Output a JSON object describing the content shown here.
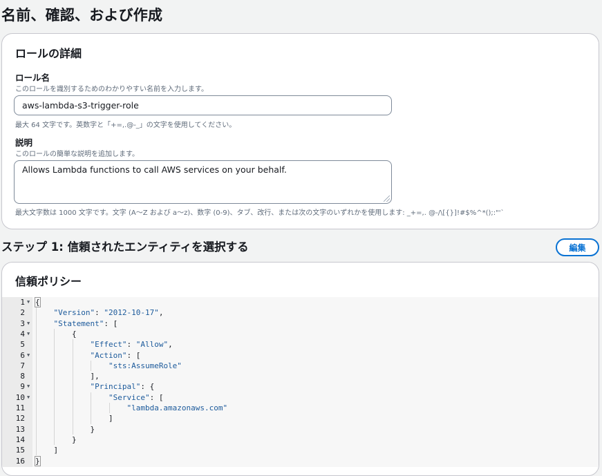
{
  "page": {
    "title": "名前、確認、および作成"
  },
  "role_details": {
    "title": "ロールの詳細",
    "role_name": {
      "label": "ロール名",
      "description": "このロールを識別するためのわかりやすい名前を入力します。",
      "value": "aws-lambda-s3-trigger-role",
      "hint": "最大 64 文字です。英数字と「+=,.@-_」の文字を使用してください。"
    },
    "description": {
      "label": "説明",
      "description": "このロールの簡単な説明を追加します。",
      "value": "Allows Lambda functions to call AWS services on your behalf.",
      "hint": "最大文字数は 1000 文字です。文字 (A〜Z および a〜z)、数字 (0-9)、タブ、改行、または次の文字のいずれかを使用します: _+=,. @-/\\[{}]!#$%^*();:\"'`"
    }
  },
  "step1": {
    "title": "ステップ 1: 信頼されたエンティティを選択する",
    "edit_label": "編集"
  },
  "trust_policy": {
    "title": "信頼ポリシー",
    "lines": [
      {
        "num": "1",
        "fold": true,
        "text": "{"
      },
      {
        "num": "2",
        "fold": false,
        "text": "    \"Version\": \"2012-10-17\","
      },
      {
        "num": "3",
        "fold": true,
        "text": "    \"Statement\": ["
      },
      {
        "num": "4",
        "fold": true,
        "text": "        {"
      },
      {
        "num": "5",
        "fold": false,
        "text": "            \"Effect\": \"Allow\","
      },
      {
        "num": "6",
        "fold": true,
        "text": "            \"Action\": ["
      },
      {
        "num": "7",
        "fold": false,
        "text": "                \"sts:AssumeRole\""
      },
      {
        "num": "8",
        "fold": false,
        "text": "            ],"
      },
      {
        "num": "9",
        "fold": true,
        "text": "            \"Principal\": {"
      },
      {
        "num": "10",
        "fold": true,
        "text": "                \"Service\": ["
      },
      {
        "num": "11",
        "fold": false,
        "text": "                    \"lambda.amazonaws.com\""
      },
      {
        "num": "12",
        "fold": false,
        "text": "                ]"
      },
      {
        "num": "13",
        "fold": false,
        "text": "            }"
      },
      {
        "num": "14",
        "fold": false,
        "text": "        }"
      },
      {
        "num": "15",
        "fold": false,
        "text": "    ]"
      },
      {
        "num": "16",
        "fold": false,
        "text": "}"
      }
    ]
  },
  "colors": {
    "accent": "#0972d3",
    "code_key": "#1c5a9b"
  }
}
